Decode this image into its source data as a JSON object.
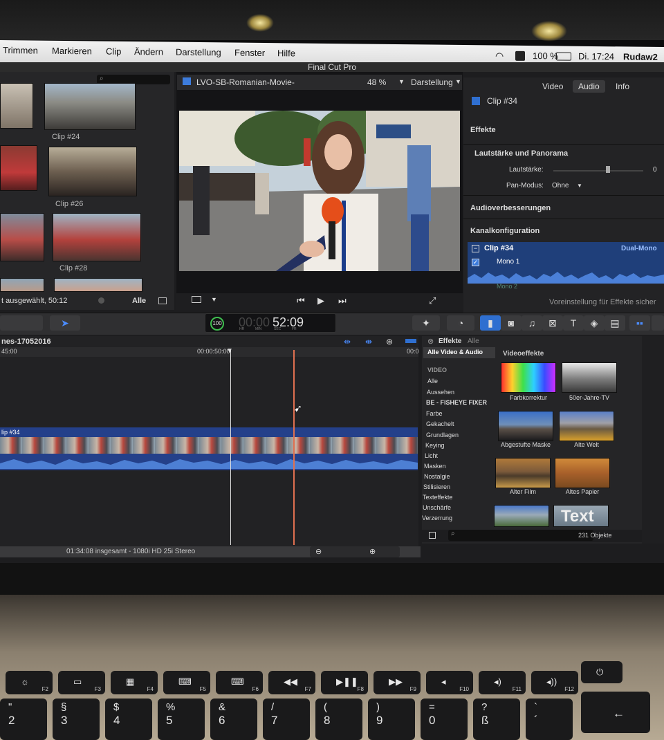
{
  "menubar": {
    "items": [
      "Trimmen",
      "Markieren",
      "Clip",
      "Ändern",
      "Darstellung",
      "Fenster",
      "Hilfe"
    ],
    "battery": "100 %",
    "clock": "Di. 17:24",
    "user": "Rudaw2"
  },
  "window_title": "Final Cut Pro",
  "browser": {
    "clips": [
      "Clip #24",
      "Clip #26",
      "Clip #28"
    ],
    "status": "t ausgewählt, 50:12",
    "filter": "Alle"
  },
  "viewer": {
    "project_name": "LVO-SB-Romanian-Movie-",
    "zoom": "48 %",
    "view_menu": "Darstellung"
  },
  "inspector": {
    "tabs": [
      "Video",
      "Audio",
      "Info"
    ],
    "clip_name": "Clip #34",
    "effects_header": "Effekte",
    "volume_section": "Lautstärke und Panorama",
    "volume_label": "Lautstärke:",
    "volume_value": "0",
    "pan_label": "Pan-Modus:",
    "pan_value": "Ohne",
    "audio_enh": "Audioverbesserungen",
    "channel_config": "Kanalkonfiguration",
    "channel_clip": "Clip #34",
    "channel_mode": "Dual-Mono",
    "channel_track": "Mono 1",
    "channel_track2": "Mono 2",
    "preset_footer": "Voreinstellung für Effekte sicher"
  },
  "toolbar": {
    "percent": "100",
    "timecode_dim": "00:00",
    "timecode": "52:09",
    "tc_units": [
      "HR",
      "MIN",
      "SEC",
      "FR"
    ]
  },
  "timeline": {
    "project": "nes-17052016",
    "ruler_left": "45:00",
    "ruler_mid": "00:00:50:00",
    "ruler_right": "00:0",
    "clip_label": "lip #34",
    "footer": "01:34:08 insgesamt - 1080i HD 25i Stereo"
  },
  "effects": {
    "title": "Effekte",
    "filter": "Alle",
    "all_label": "Alle Video & Audio",
    "section": "Videoeffekte",
    "group": "VIDEO",
    "categories": [
      "Alle",
      "Aussehen",
      "BE - FISHEYE FIXER",
      "Farbe",
      "Gekachelt",
      "Grundlagen",
      "Keying",
      "Licht",
      "Masken",
      "Nostalgie",
      "Stilisieren",
      "Texteffekte",
      "Unschärfe",
      "Verzerrung"
    ],
    "items": [
      "Farbkorrektur",
      "50er-Jahre-TV",
      "Abgestufte Maske",
      "Alte Welt",
      "Alter Film",
      "Altes Papier"
    ],
    "text_thumb": "Text",
    "count": "231 Objekte"
  },
  "keyboard": {
    "fkeys": [
      "F2",
      "F3",
      "F4",
      "F5",
      "F6",
      "F7",
      "F8",
      "F9",
      "F10",
      "F11",
      "F12"
    ],
    "num_top": [
      "\"",
      "§",
      "$",
      "%",
      "&",
      "/",
      "(",
      ")",
      "=",
      "?",
      "`"
    ],
    "num_bottom": [
      "2",
      "3",
      "4",
      "5",
      "6",
      "7",
      "8",
      "9",
      "0",
      "ß",
      "´"
    ],
    "backspace": "←"
  }
}
